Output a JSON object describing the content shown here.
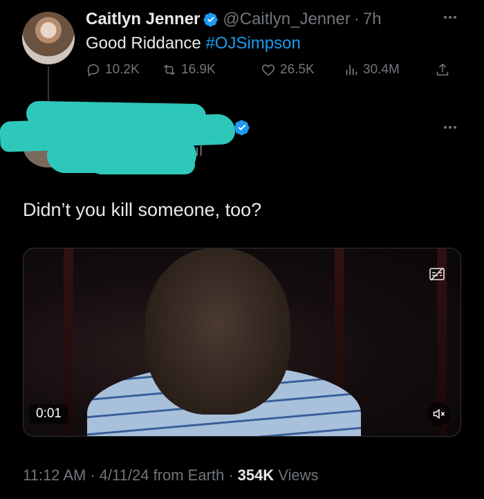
{
  "tweet": {
    "display_name": "Caitlyn Jenner",
    "handle": "@Caitlyn_Jenner",
    "time": "7h",
    "separator": "·",
    "text": "Good Riddance ",
    "hashtag": "#OJSimpson",
    "stats": {
      "replies": "10.2K",
      "retweets": "16.9K",
      "likes": "26.5K",
      "views": "30.4M"
    }
  },
  "reply": {
    "handle_fragment": "ıl",
    "text": "Didn’t you kill someone, too?",
    "video": {
      "timestamp": "0:01"
    },
    "meta": {
      "time": "11:12 AM",
      "date": "4/11/24",
      "source": "from Earth",
      "views_count": "354K",
      "views_label": "Views",
      "separator": "·"
    }
  },
  "colors": {
    "background": "#000000",
    "accent": "#1d9bf0",
    "muted": "#71767b",
    "redaction": "#2ec8bb"
  },
  "icons": [
    "reply-icon",
    "retweet-icon",
    "like-icon",
    "views-icon",
    "share-icon",
    "verified-badge-icon",
    "more-icon",
    "captions-icon",
    "mute-icon"
  ]
}
